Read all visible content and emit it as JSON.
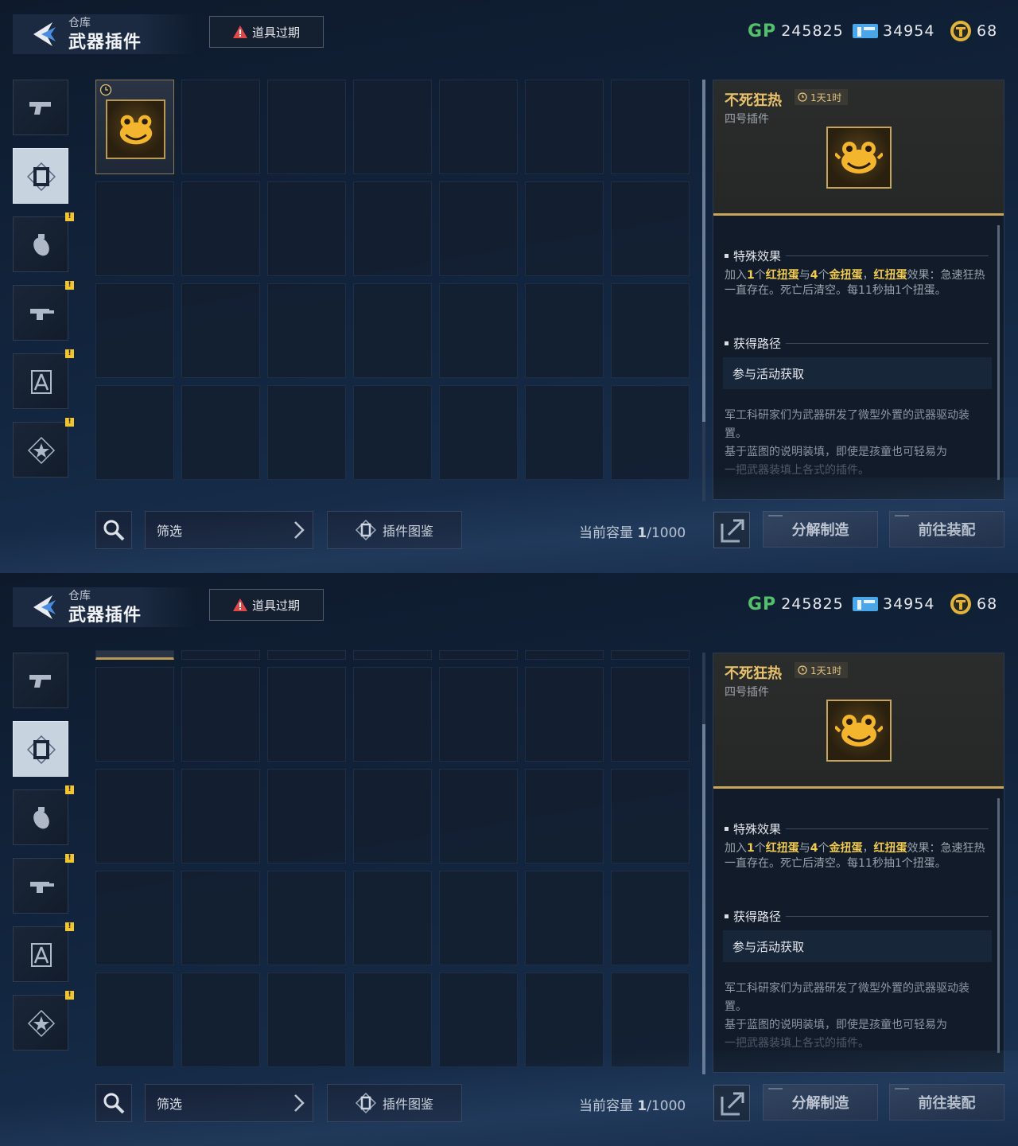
{
  "header": {
    "breadcrumb": "仓库",
    "title": "武器插件",
    "expire_button": "道具过期"
  },
  "currencies": [
    {
      "icon": "gp-icon",
      "label": "GP",
      "value": "245825"
    },
    {
      "icon": "ticket-icon",
      "value": "34954"
    },
    {
      "icon": "gold-coin-icon",
      "value": "68"
    }
  ],
  "sidebar": [
    {
      "icon": "pistol-icon",
      "active": false,
      "alert": false
    },
    {
      "icon": "plugin-icon",
      "active": true,
      "alert": false
    },
    {
      "icon": "grenade-icon",
      "active": false,
      "alert": true
    },
    {
      "icon": "weapon-mod-icon",
      "active": false,
      "alert": true
    },
    {
      "icon": "blueprint-icon",
      "active": false,
      "alert": true
    },
    {
      "icon": "star-badge-icon",
      "active": false,
      "alert": true
    }
  ],
  "alert_mark": "!",
  "inventory": {
    "columns": 7,
    "rows": 4,
    "items": [
      {
        "slot": 0,
        "icon": "frog-plugin-icon",
        "timed": true
      }
    ]
  },
  "detail": {
    "name": "不死狂热",
    "timer": "1天1时",
    "subtype": "四号插件",
    "effect_title": "特殊效果",
    "effect": {
      "p1": "加入",
      "n1": "1",
      "p2": "个",
      "red": "红扭蛋",
      "p3": "与",
      "n2": "4",
      "p4": "个",
      "gold": "金扭蛋",
      "p5": "，",
      "red2": "红扭蛋",
      "p6": "效果：急速狂热一直存在。死亡后清空。每11秒抽1个扭蛋。"
    },
    "route_title": "获得路径",
    "route": "参与活动获取",
    "lore1": "军工科研家们为武器研发了微型外置的武器驱动装置。",
    "lore2": "基于蓝图的说明装填，即使是孩童也可轻易为",
    "lore3": "一把武器装填上各式的插件。"
  },
  "bottom": {
    "filter": "筛选",
    "catalog": "插件图鉴",
    "capacity_label": "当前容量",
    "capacity_used": "1",
    "capacity_total": "/1000",
    "decompose": "分解制造",
    "equip": "前往装配"
  },
  "colors": {
    "accent_gold": "#e9c36a",
    "highlight_yellow": "#f2cc4c",
    "gp_green": "#53c16b",
    "ticket_blue": "#4aa6e8"
  }
}
